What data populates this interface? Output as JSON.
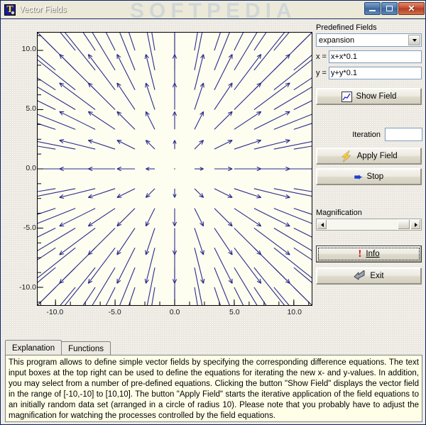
{
  "window": {
    "title": "Vector Fields",
    "icon": "app-icon-T",
    "watermark": "SOFTPEDIA",
    "buttons": {
      "minimize": "minimize-icon",
      "maximize": "maximize-icon",
      "close": "✕"
    }
  },
  "right_panel": {
    "predefined_label": "Predefined Fields",
    "predefined_value": "expansion",
    "dropdown_icon": "chevron-down-icon",
    "x_label": "x =",
    "x_value": "x+x*0.1",
    "y_label": "y =",
    "y_value": "y+y*0.1",
    "show_field_label": "Show Field",
    "show_field_icon": "chart-line-icon",
    "iteration_label": "Iteration",
    "iteration_value": "",
    "apply_field_label": "Apply Field",
    "apply_field_icon": "lightning-bolt-icon",
    "stop_label": "Stop",
    "stop_icon": "arrow-right-icon",
    "magnification_label": "Magnification",
    "scroll_left_icon": "triangle-left-icon",
    "scroll_right_icon": "triangle-right-icon",
    "info_label": "Info",
    "info_icon": "exclamation-icon",
    "exit_label": "Exit",
    "exit_icon": "exit-arrow-icon"
  },
  "tabs": [
    {
      "label": "Explanation",
      "active": true
    },
    {
      "label": "Functions",
      "active": false
    }
  ],
  "explanation": "This program allows to define simple vector fields by specifying the corresponding difference equations. The text input boxes at the top right can be used to define the equations for iterating the new x- and y-values. In addition, you may select from a number of pre-defined equations. Clicking the button \"Show Field\" displays the vector field in the range of [-10,-10] to [10,10]. The button \"Apply Field\" starts the iterative application of the field equations to an initially random data set (arranged in a circle of radius 10). Please note that you probably have to adjust the magnification for watching the processes controlled by the field equations.",
  "chart_data": {
    "type": "scatter",
    "title": "",
    "xlabel": "",
    "ylabel": "",
    "xlim": [
      -11.5,
      11.5
    ],
    "ylim": [
      -11.5,
      11.5
    ],
    "grid": false,
    "field_equation_x": "x+x*0.1",
    "field_equation_y": "y+y*0.1",
    "x_ticks": [
      -10.0,
      -5.0,
      0.0,
      5.0,
      10.0
    ],
    "y_ticks": [
      -10.0,
      -5.0,
      0.0,
      5.0,
      10.0
    ],
    "x_tick_labels": [
      "-10.0",
      "-5.0",
      "0.0",
      "5.0",
      "10.0"
    ],
    "y_tick_labels": [
      "-10.0",
      "-5.0",
      "0.0",
      "5.0",
      "10.0"
    ],
    "minor_tick_step": 1.25,
    "arrow_color": "#2a2a8c",
    "plot_background": "#fdfdf0",
    "grid_points_x": [
      -10,
      -8.3333,
      -6.6667,
      -5,
      -3.3333,
      -1.6667,
      0,
      1.6667,
      3.3333,
      5,
      6.6667,
      8.3333,
      10
    ],
    "grid_points_y": [
      -10,
      -8.3333,
      -6.6667,
      -5,
      -3.3333,
      -1.6667,
      0,
      1.6667,
      3.3333,
      5,
      6.6667,
      8.3333,
      10
    ],
    "vector_rule": "u = 0.1*x, v = 0.1*y (radial expansion field)",
    "vector_scale": 4.5
  }
}
